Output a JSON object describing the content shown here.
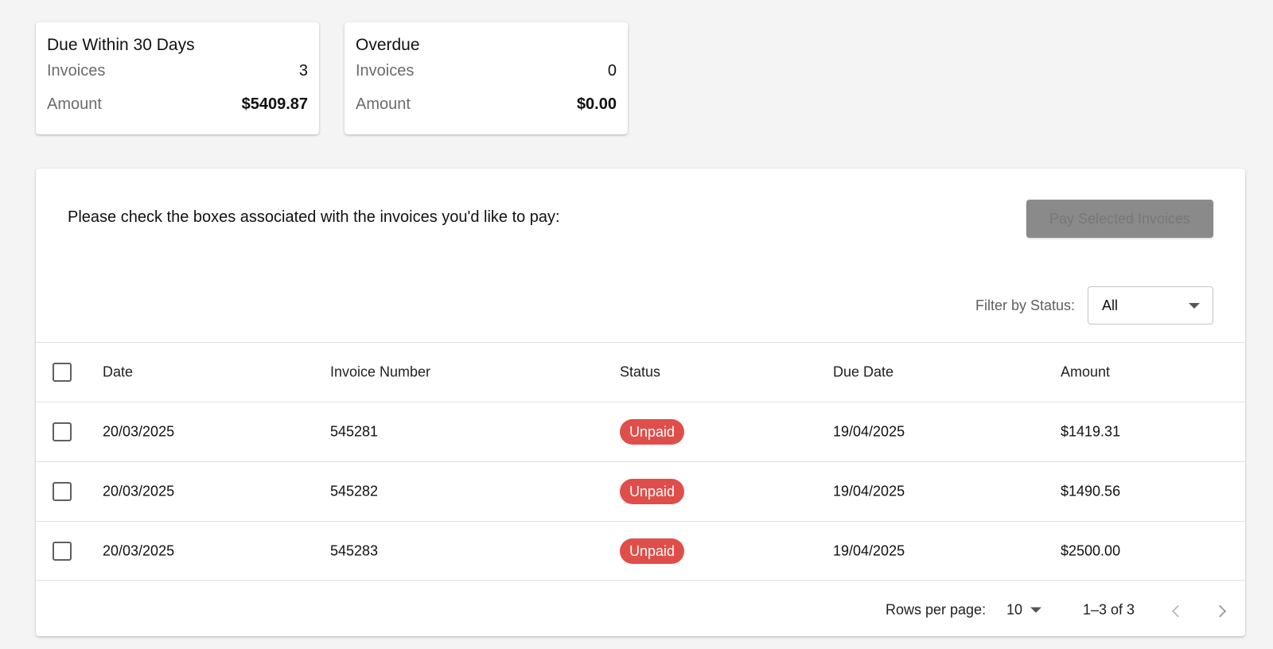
{
  "summary": {
    "due_soon": {
      "title": "Due Within 30 Days",
      "invoices_label": "Invoices",
      "invoices_count": "3",
      "amount_label": "Amount",
      "amount_value": "$5409.87"
    },
    "overdue": {
      "title": "Overdue",
      "invoices_label": "Invoices",
      "invoices_count": "0",
      "amount_label": "Amount",
      "amount_value": "$0.00"
    }
  },
  "panel": {
    "instructions": "Please check the boxes associated with the invoices you'd like to pay:",
    "pay_button_label": "Pay Selected Invoices",
    "filter_label": "Filter by Status:",
    "filter_value": "All"
  },
  "table": {
    "headers": {
      "date": "Date",
      "invoice_number": "Invoice Number",
      "status": "Status",
      "due_date": "Due Date",
      "amount": "Amount"
    },
    "rows": [
      {
        "date": "20/03/2025",
        "invoice_number": "545281",
        "status": "Unpaid",
        "due_date": "19/04/2025",
        "amount": "$1419.31"
      },
      {
        "date": "20/03/2025",
        "invoice_number": "545282",
        "status": "Unpaid",
        "due_date": "19/04/2025",
        "amount": "$1490.56"
      },
      {
        "date": "20/03/2025",
        "invoice_number": "545283",
        "status": "Unpaid",
        "due_date": "19/04/2025",
        "amount": "$2500.00"
      }
    ]
  },
  "pagination": {
    "rows_per_page_label": "Rows per page:",
    "rows_per_page_value": "10",
    "range_text": "1–3 of 3"
  },
  "colors": {
    "badge_unpaid": "#e04e4a",
    "button_disabled": "#8a8a8a",
    "background": "#f4f4f4"
  },
  "icons": {
    "filter_dropdown": "chevron-down-icon",
    "rows_dropdown": "chevron-down-icon",
    "prev_page": "chevron-left-icon",
    "next_page": "chevron-right-icon"
  }
}
